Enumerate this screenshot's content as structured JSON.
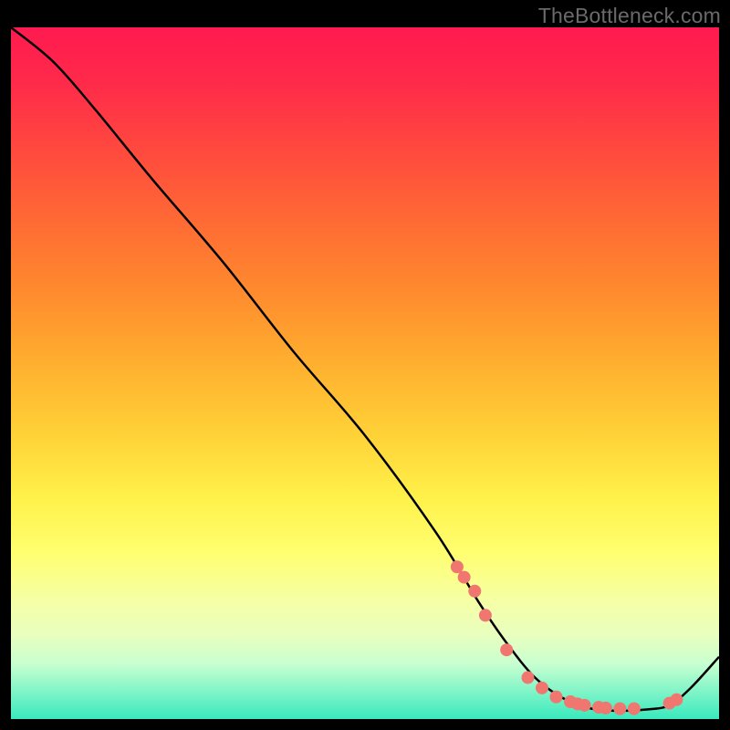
{
  "watermark": "TheBottleneck.com",
  "chart_data": {
    "type": "line",
    "title": "",
    "xlabel": "",
    "ylabel": "",
    "xlim": [
      0,
      100
    ],
    "ylim": [
      0,
      100
    ],
    "x": [
      0,
      6,
      12,
      20,
      30,
      40,
      50,
      60,
      66,
      70,
      74,
      78,
      82,
      86,
      90,
      93,
      96,
      100
    ],
    "values": [
      100,
      95,
      88,
      78,
      66,
      53,
      41,
      27,
      17,
      11,
      6,
      3,
      1.5,
      1.2,
      1.4,
      2,
      4.5,
      9
    ],
    "dots_x": [
      63,
      64,
      65.5,
      67,
      70,
      73,
      75,
      77,
      79,
      80,
      81,
      83,
      84,
      86,
      88,
      93,
      94
    ],
    "dots_y": [
      22,
      20.5,
      18.5,
      15,
      10,
      6,
      4.5,
      3.2,
      2.5,
      2.2,
      2.0,
      1.7,
      1.6,
      1.5,
      1.5,
      2.3,
      2.8
    ]
  },
  "colors": {
    "dot": "#f0776f",
    "curve": "#000000",
    "gradient_top": "#ff1a4f",
    "gradient_bottom": "#38e9bd"
  }
}
